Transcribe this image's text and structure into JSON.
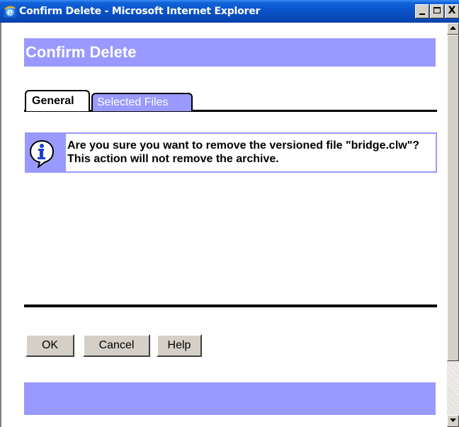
{
  "window": {
    "title": "Confirm Delete - Microsoft Internet Explorer",
    "icon": "ie-icon",
    "caption_buttons": [
      "minimize-icon",
      "maximize-icon",
      "close-icon"
    ],
    "close_glyph": "X"
  },
  "header": {
    "title": "Confirm Delete"
  },
  "tabs": [
    {
      "label": "General",
      "active": true
    },
    {
      "label": "Selected Files",
      "active": false
    }
  ],
  "message": {
    "icon": "info-icon",
    "text": "Are you sure you want to remove the versioned file \"bridge.clw\"? This action will not remove the archive."
  },
  "buttons": {
    "ok": "OK",
    "cancel": "Cancel",
    "help": "Help"
  },
  "colors": {
    "accent": "#9999ff",
    "titlebar": "#0a52c9",
    "button_face": "#d4d0c8"
  }
}
